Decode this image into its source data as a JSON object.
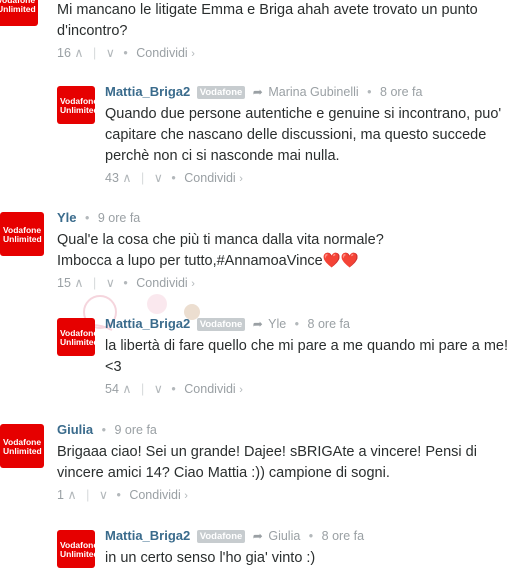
{
  "brand": {
    "line1": "Vodafone",
    "line2": "Unlimited"
  },
  "labels": {
    "badge": "Vodafone",
    "share": "Condividi",
    "separator": "•",
    "chevron": "›"
  },
  "comments": [
    {
      "author": "",
      "text1": "Mi mancano le litigate Emma e Briga ahah avete trovato un punto",
      "text2": "d'incontro?",
      "votes": "16"
    },
    {
      "author": "Mattia_Briga2",
      "reply_to": "Marina Gubinelli",
      "time": "8 ore fa",
      "text1": "Quando due persone autentiche e genuine si incontrano, puo'",
      "text2": "capitare che nascano delle discussioni, ma questo succede",
      "text3": "perchè non ci si nasconde mai nulla.",
      "votes": "43"
    },
    {
      "author": "Yle",
      "time": "9 ore fa",
      "text1": "Qual'e la cosa che più ti manca dalla vita normale?",
      "text2": "Imbocca a lupo per tutto,#AnnamoaVince❤️❤️",
      "votes": "15"
    },
    {
      "author": "Mattia_Briga2",
      "reply_to": "Yle",
      "time": "8 ore fa",
      "text1": "la libertà di fare quello che mi pare a me quando mi pare a me!",
      "text2": "<3",
      "votes": "54"
    },
    {
      "author": "Giulia",
      "time": "9 ore fa",
      "text1": "Brigaaa ciao! Sei un grande! Dajee! sBRIGAte a vincere! Pensi di",
      "text2": "vincere amici 14? Ciao Mattia :)) campione di sogni.",
      "votes": "1"
    },
    {
      "author": "Mattia_Briga2",
      "reply_to": "Giulia",
      "time": "8 ore fa",
      "text1": "in un certo senso l'ho gia' vinto :)"
    }
  ]
}
